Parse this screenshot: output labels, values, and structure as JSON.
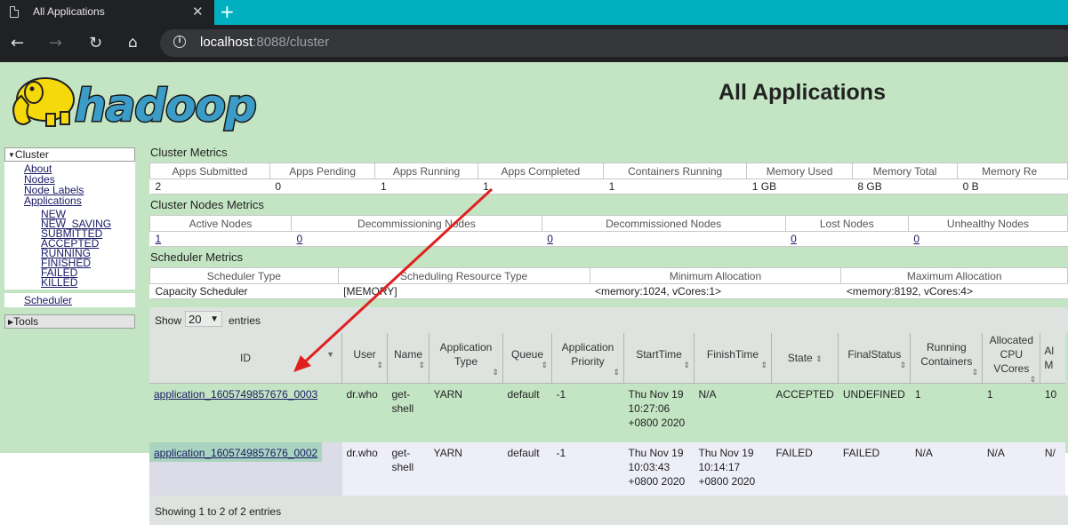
{
  "browser": {
    "tab_title": "All Applications",
    "tab_close": "✕",
    "new_tab": "+",
    "url_host": "localhost",
    "url_rest": ":8088/cluster"
  },
  "header": {
    "title": "All Applications"
  },
  "nav": {
    "cluster_label": "Cluster",
    "cluster_items": [
      "About",
      "Nodes",
      "Node Labels",
      "Applications"
    ],
    "app_states": [
      "NEW",
      "NEW_SAVING",
      "SUBMITTED",
      "ACCEPTED",
      "RUNNING",
      "FINISHED",
      "FAILED",
      "KILLED"
    ],
    "scheduler": "Scheduler",
    "tools_label": "Tools"
  },
  "cluster_metrics": {
    "title": "Cluster Metrics",
    "headers": [
      "Apps Submitted",
      "Apps Pending",
      "Apps Running",
      "Apps Completed",
      "Containers Running",
      "Memory Used",
      "Memory Total",
      "Memory Re"
    ],
    "values": [
      "2",
      "0",
      "1",
      "1",
      "1",
      "1 GB",
      "8 GB",
      "0 B"
    ]
  },
  "cluster_nodes_metrics": {
    "title": "Cluster Nodes Metrics",
    "headers": [
      "Active Nodes",
      "Decommissioning Nodes",
      "Decommissioned Nodes",
      "Lost Nodes",
      "Unhealthy Nodes"
    ],
    "values": [
      "1",
      "0",
      "0",
      "0",
      "0"
    ]
  },
  "scheduler_metrics": {
    "title": "Scheduler Metrics",
    "headers": [
      "Scheduler Type",
      "Scheduling Resource Type",
      "Minimum Allocation",
      "Maximum Allocation"
    ],
    "values": [
      "Capacity Scheduler",
      "[MEMORY]",
      "<memory:1024, vCores:1>",
      "<memory:8192, vCores:4>"
    ]
  },
  "apps_table": {
    "show_label": "Show",
    "entries_value": "20",
    "entries_label": "entries",
    "headers": {
      "id": "ID",
      "user": "User",
      "name": "Name",
      "app_type": "Application Type",
      "queue": "Queue",
      "priority": "Application Priority",
      "start": "StartTime",
      "finish": "FinishTime",
      "state": "State",
      "final": "FinalStatus",
      "containers": "Running Containers",
      "cpu": "Allocated CPU VCores",
      "mem": "Al M"
    },
    "rows": [
      {
        "id": "application_1605749857676_0003",
        "user": "dr.who",
        "name": "get-shell",
        "type": "YARN",
        "queue": "default",
        "priority": "-1",
        "start": "Thu Nov 19 10:27:06 +0800 2020",
        "finish": "N/A",
        "state": "ACCEPTED",
        "final": "UNDEFINED",
        "containers": "1",
        "cpu": "1",
        "mem": "10"
      },
      {
        "id": "application_1605749857676_0002",
        "user": "dr.who",
        "name": "get-shell",
        "type": "YARN",
        "queue": "default",
        "priority": "-1",
        "start": "Thu Nov 19 10:03:43 +0800 2020",
        "finish": "Thu Nov 19 10:14:17 +0800 2020",
        "state": "FAILED",
        "final": "FAILED",
        "containers": "N/A",
        "cpu": "N/A",
        "mem": "N/"
      }
    ],
    "footer": "Showing 1 to 2 of 2 entries"
  },
  "colors": {
    "page_green": "#c4e5c4",
    "arrow_red": "#e02020",
    "tab_bar": "#00b0c0"
  },
  "logo": {
    "text": "hadoop"
  }
}
